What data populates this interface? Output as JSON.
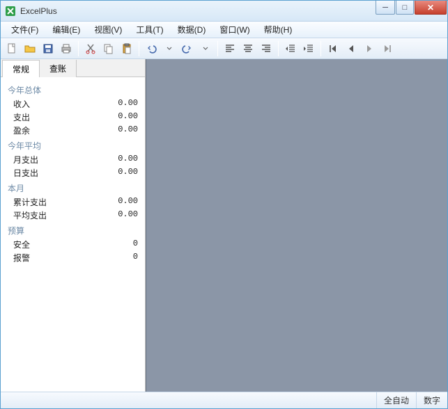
{
  "window": {
    "title": "ExcelPlus"
  },
  "menu": {
    "file": "文件(F)",
    "edit": "编辑(E)",
    "view": "视图(V)",
    "tools": "工具(T)",
    "data": "数据(D)",
    "window": "窗口(W)",
    "help": "帮助(H)"
  },
  "toolbar_icons": {
    "new": "new-icon",
    "open": "open-icon",
    "save": "save-icon",
    "print": "print-icon",
    "cut": "cut-icon",
    "copy": "copy-icon",
    "paste": "paste-icon",
    "undo": "undo-icon",
    "redo": "redo-icon",
    "align_left": "align-left-icon",
    "align_center": "align-center-icon",
    "align_right": "align-right-icon",
    "indent": "indent-icon",
    "outdent": "outdent-icon",
    "first": "first-icon",
    "prev": "prev-icon",
    "next": "next-icon",
    "last": "last-icon"
  },
  "sidebar": {
    "tabs": [
      {
        "label": "常规"
      },
      {
        "label": "查账"
      }
    ],
    "groups": [
      {
        "header": "今年总体",
        "rows": [
          {
            "label": "收入",
            "value": "0.00"
          },
          {
            "label": "支出",
            "value": "0.00"
          },
          {
            "label": "盈余",
            "value": "0.00"
          }
        ]
      },
      {
        "header": "今年平均",
        "rows": [
          {
            "label": "月支出",
            "value": "0.00"
          },
          {
            "label": "日支出",
            "value": "0.00"
          }
        ]
      },
      {
        "header": "本月",
        "rows": [
          {
            "label": "累计支出",
            "value": "0.00"
          },
          {
            "label": "平均支出",
            "value": "0.00"
          }
        ]
      },
      {
        "header": "预算",
        "rows": [
          {
            "label": "安全",
            "value": "0"
          },
          {
            "label": "报警",
            "value": "0"
          }
        ]
      }
    ]
  },
  "status": {
    "auto": "全自动",
    "num": "数字"
  }
}
